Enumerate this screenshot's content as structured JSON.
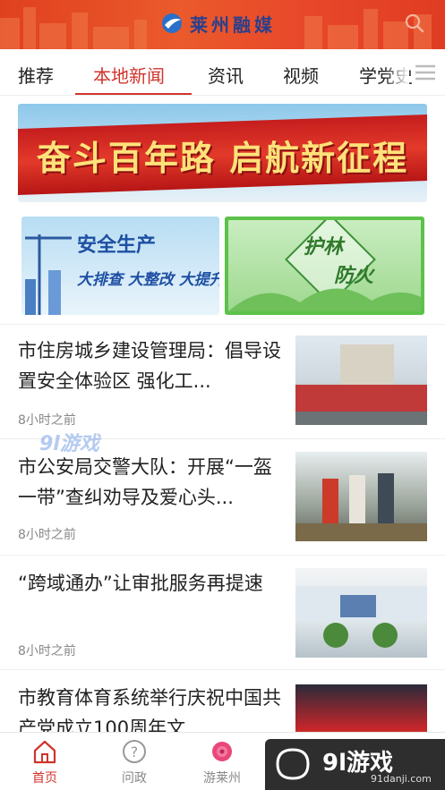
{
  "header": {
    "app_name": "莱州融媒",
    "search_icon": "search-icon"
  },
  "tabs": [
    {
      "label": "推荐",
      "active": false
    },
    {
      "label": "本地新闻",
      "active": true
    },
    {
      "label": "资讯",
      "active": false
    },
    {
      "label": "视频",
      "active": false
    },
    {
      "label": "学党史",
      "active": false
    }
  ],
  "banner": {
    "text": "奋斗百年路 启航新征程"
  },
  "tiles": {
    "left": {
      "line1": "安全生产",
      "line2": "大排查 大整改 大提升"
    },
    "right": {
      "line1": "护林",
      "line2": "防火"
    }
  },
  "news": [
    {
      "title": "市住房城乡建设管理局：倡导设置安全体验区 强化工...",
      "time": "8小时之前"
    },
    {
      "title": "市公安局交警大队：开展“一盔一带”查纠劝导及爱心头...",
      "time": "8小时之前"
    },
    {
      "title": "“跨域通办”让审批服务再提速",
      "time": "8小时之前"
    },
    {
      "title": "市教育体育系统举行庆祝中国共产党成立100周年文...",
      "time": ""
    }
  ],
  "watermark": {
    "text": "9l游戏"
  },
  "bottom_nav": [
    {
      "label": "首页",
      "icon": "home-icon",
      "active": true
    },
    {
      "label": "问政",
      "icon": "question-icon",
      "active": false
    },
    {
      "label": "游莱州",
      "icon": "flower-icon",
      "active": false
    }
  ],
  "corner_watermark": {
    "big": "9l游戏",
    "small": "91danji.com"
  },
  "colors": {
    "accent": "#d0342c",
    "header_bg": "#e8472a"
  }
}
